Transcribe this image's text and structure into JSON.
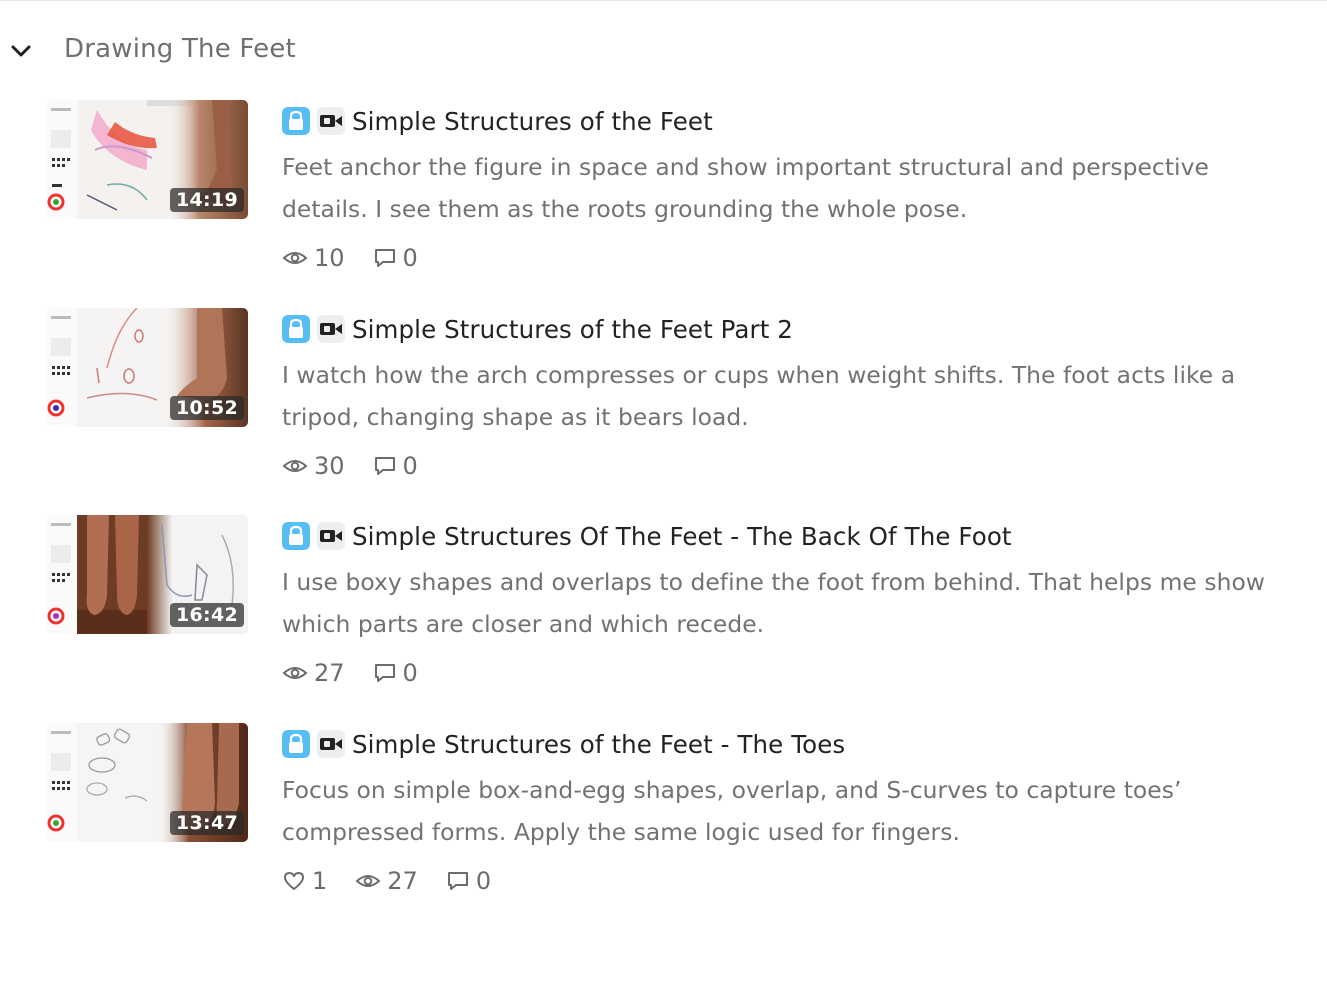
{
  "section": {
    "title": "Drawing The Feet"
  },
  "colors": {
    "lock_badge": "#57bdf5",
    "title_text": "#222222",
    "muted_text": "#727272",
    "duration_bg": "#282828"
  },
  "lessons": [
    {
      "title": "Simple Structures of the Feet",
      "description": "Feet anchor the figure in space and show important structural and perspective details. I see them as the roots grounding the whole pose.",
      "duration": "14:19",
      "views": "10",
      "comments": "0",
      "icons": [
        "lock-icon",
        "video-camera-icon",
        "eye-icon",
        "comment-icon"
      ]
    },
    {
      "title": "Simple Structures of the Feet Part 2",
      "description": "I watch how the arch compresses or cups when weight shifts. The foot acts like a tripod, changing shape as it bears load.",
      "duration": "10:52",
      "views": "30",
      "comments": "0",
      "icons": [
        "lock-icon",
        "video-camera-icon",
        "eye-icon",
        "comment-icon"
      ]
    },
    {
      "title": "Simple Structures Of The Feet - The Back Of The Foot",
      "description": "I use boxy shapes and overlaps to define the foot from behind. That helps me show which parts are closer and which recede.",
      "duration": "16:42",
      "views": "27",
      "comments": "0",
      "icons": [
        "lock-icon",
        "video-camera-icon",
        "eye-icon",
        "comment-icon"
      ]
    },
    {
      "title": "Simple Structures of the Feet - The Toes",
      "description": "Focus on simple box-and-egg shapes, overlap, and S-curves to capture toes’ compressed forms. Apply the same logic used for fingers.",
      "duration": "13:47",
      "likes": "1",
      "views": "27",
      "comments": "0",
      "icons": [
        "lock-icon",
        "video-camera-icon",
        "heart-icon",
        "eye-icon",
        "comment-icon"
      ]
    }
  ]
}
